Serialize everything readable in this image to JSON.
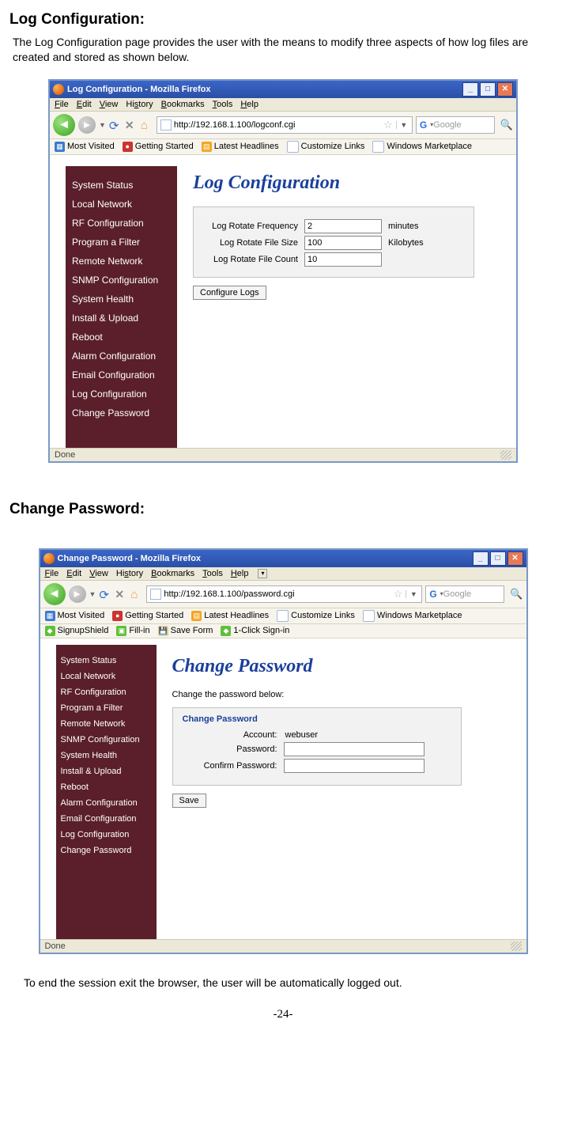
{
  "doc": {
    "heading1": "Log Configuration:",
    "text1": "The Log Configuration page provides the user with the means to modify three aspects of how log files are created and stored as shown below.",
    "heading2": "Change Password:",
    "footer": "To end the session exit  the browser, the user will be automatically logged out.",
    "page_num": "-24-"
  },
  "shot1": {
    "title": "Log Configuration - Mozilla Firefox",
    "menu": {
      "file": "File",
      "edit": "Edit",
      "view": "View",
      "history": "History",
      "bookmarks": "Bookmarks",
      "tools": "Tools",
      "help": "Help"
    },
    "url": "http://192.168.1.100/logconf.cgi",
    "search_ph": "Google",
    "bookmarks": {
      "most_visited": "Most Visited",
      "getting_started": "Getting Started",
      "latest_headlines": "Latest Headlines",
      "customize_links": "Customize Links",
      "marketplace": "Windows Marketplace"
    },
    "sidebar": [
      "System Status",
      "Local Network",
      "RF Configuration",
      "Program a Filter",
      "Remote Network",
      "SNMP Configuration",
      "System Health",
      "Install & Upload",
      "Reboot",
      "Alarm Configuration",
      "Email Configuration",
      "Log Configuration",
      "Change Password"
    ],
    "main_title": "Log Configuration",
    "form": {
      "row1_lbl": "Log Rotate Frequency",
      "row1_val": "2",
      "row1_unit": "minutes",
      "row2_lbl": "Log Rotate File Size",
      "row2_val": "100",
      "row2_unit": "Kilobytes",
      "row3_lbl": "Log Rotate File Count",
      "row3_val": "10",
      "button": "Configure Logs"
    },
    "status": "Done"
  },
  "shot2": {
    "title": "Change Password - Mozilla Firefox",
    "menu": {
      "file": "File",
      "edit": "Edit",
      "view": "View",
      "history": "History",
      "bookmarks": "Bookmarks",
      "tools": "Tools",
      "help": "Help"
    },
    "url": "http://192.168.1.100/password.cgi",
    "search_ph": "Google",
    "bookmarks": {
      "most_visited": "Most Visited",
      "getting_started": "Getting Started",
      "latest_headlines": "Latest Headlines",
      "customize_links": "Customize Links",
      "marketplace": "Windows Marketplace"
    },
    "toolbar2": {
      "signup": "SignupShield",
      "fillin": "Fill-in",
      "saveform": "Save Form",
      "oneclick": "1-Click Sign-in"
    },
    "sidebar": [
      "System Status",
      "Local Network",
      "RF Configuration",
      "Program a Filter",
      "Remote Network",
      "SNMP Configuration",
      "System Health",
      "Install & Upload",
      "Reboot",
      "Alarm Configuration",
      "Email Configuration",
      "Log Configuration",
      "Change Password"
    ],
    "main_title": "Change Password",
    "main_sub": "Change the password below:",
    "form": {
      "legend": "Change Password",
      "row1_lbl": "Account:",
      "row1_val": "webuser",
      "row2_lbl": "Password:",
      "row2_val": "",
      "row3_lbl": "Confirm Password:",
      "row3_val": "",
      "button": "Save"
    },
    "status": "Done"
  }
}
